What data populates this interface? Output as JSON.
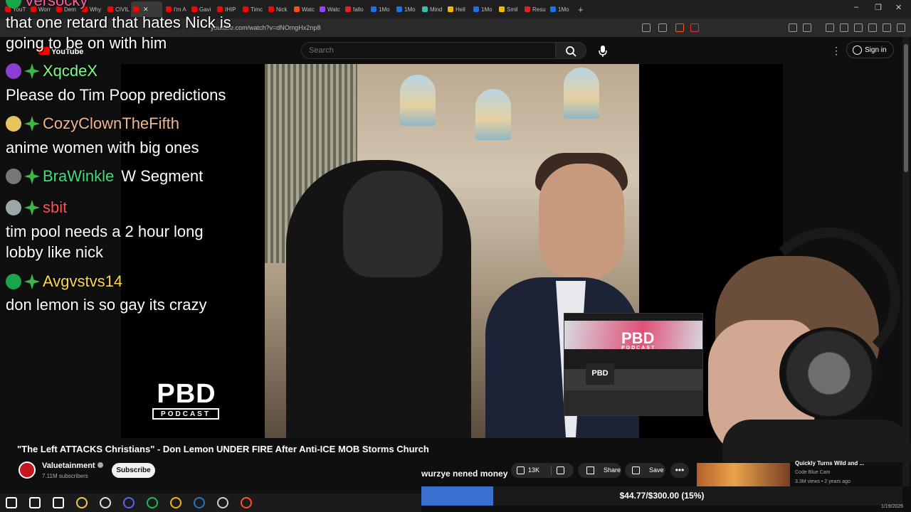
{
  "browser": {
    "tabs": [
      {
        "label": "YouT",
        "color": "#ff0000"
      },
      {
        "label": "Worr",
        "color": "#ff0000"
      },
      {
        "label": "Dem",
        "color": "#ff0000"
      },
      {
        "label": "Why",
        "color": "#ff0000"
      },
      {
        "label": "CIVIL",
        "color": "#ff0000"
      },
      {
        "label": "",
        "color": "#ff0000",
        "active": true
      },
      {
        "label": "I'm A",
        "color": "#ff0000"
      },
      {
        "label": "Gavi",
        "color": "#ff0000"
      },
      {
        "label": "IHIP",
        "color": "#ff0000"
      },
      {
        "label": "Timc",
        "color": "#ff0000"
      },
      {
        "label": "Nick",
        "color": "#ff0000"
      },
      {
        "label": "Watc",
        "color": "#ff4d1a"
      },
      {
        "label": "Watc",
        "color": "#9147ff"
      },
      {
        "label": "fallo",
        "color": "#e02424"
      },
      {
        "label": "1Mo",
        "color": "#1a73e8"
      },
      {
        "label": "1Mo",
        "color": "#1a73e8"
      },
      {
        "label": "Mind",
        "color": "#36c0a8"
      },
      {
        "label": "Hell",
        "color": "#f2b705"
      },
      {
        "label": "1Mo",
        "color": "#1a73e8"
      },
      {
        "label": "Smil",
        "color": "#f2b705"
      },
      {
        "label": "Resu",
        "color": "#e02424"
      },
      {
        "label": "1Mo",
        "color": "#1a73e8"
      }
    ],
    "new_tab": "+",
    "url": "youtube.com/watch?v=dNOmgHx2np8",
    "window_controls": {
      "minimize": "–",
      "restore": "❐",
      "close": "✕"
    }
  },
  "youtube": {
    "logo": "YouTube",
    "search_placeholder": "Search",
    "more_menu": "⋮",
    "sign_in": "Sign in",
    "video_title": "\"The Left ATTACKS Christians\" - Don Lemon UNDER FIRE After Anti-ICE MOB Storms Church",
    "channel": {
      "name": "Valuetainment",
      "subscribers": "7.11M subscribers",
      "subscribe": "Subscribe"
    },
    "actions": {
      "likes": "13K",
      "share": "Share",
      "save": "Save",
      "more": "•••"
    },
    "recommended": {
      "title": "Quickly Turns Wild and ...",
      "channel": "Code Blue Cam",
      "meta": "3.3M views • 2 years ago"
    }
  },
  "chat": {
    "top_user": "Versocky",
    "messages": [
      {
        "type": "text",
        "text": "that one retard that hates Nick is"
      },
      {
        "type": "text",
        "text": "going to be on with him"
      },
      {
        "type": "user",
        "name": "XqcdeX",
        "color": "#7cff83",
        "badge_color": "#8b3fd0"
      },
      {
        "type": "text",
        "text": "Please do Tim Poop predictions"
      },
      {
        "type": "user",
        "name": "CozyClownTheFifth",
        "color": "#f1b58f",
        "badge_color": "#e6c35c"
      },
      {
        "type": "text",
        "text": "anime women with big ones"
      },
      {
        "type": "user",
        "name": "BraWinkle",
        "color": "#3ee07a",
        "badge_color": "#777777",
        "inline": "W Segment"
      },
      {
        "type": "user",
        "name": "sbit",
        "color": "#ff5252",
        "badge_color": "#9aa6a8"
      },
      {
        "type": "text",
        "text": "tim pool needs a 2 hour long"
      },
      {
        "type": "text",
        "text": "lobby like nick"
      },
      {
        "type": "user",
        "name": "Avgvstvs14",
        "color": "#ffd84a",
        "badge_color": "#19a64a"
      },
      {
        "type": "text",
        "text": "don lemon is so gay its crazy"
      }
    ]
  },
  "overlay": {
    "pbd_logo": "PBD",
    "pbd_sub": "PODCAST",
    "pip_logo": "PBD",
    "pip_sub": "PODCAST",
    "pip_desk": "PBD",
    "tts_text": "wurzye nened money",
    "goal": {
      "label": "$44.77/$300.00 (15%)",
      "progress": 0.15,
      "color": "#3a6fd0"
    }
  },
  "taskbar": {
    "icons": [
      {
        "name": "windows-start-icon",
        "color": "#ffffff"
      },
      {
        "name": "taskbar-search-icon",
        "color": "#ffffff"
      },
      {
        "name": "task-view-icon",
        "color": "#ffffff"
      },
      {
        "name": "file-explorer-icon",
        "color": "#f5c84b"
      },
      {
        "name": "obs-icon",
        "color": "#e0e0e0"
      },
      {
        "name": "discord-icon",
        "color": "#5865f2"
      },
      {
        "name": "spotify-icon",
        "color": "#1db954"
      },
      {
        "name": "chrome-icon",
        "color": "#f2b705"
      },
      {
        "name": "steam-icon",
        "color": "#2a75bb"
      },
      {
        "name": "settings-icon",
        "color": "#cfcfcf"
      },
      {
        "name": "brave-icon",
        "color": "#fb542b"
      }
    ],
    "clock": "1/19/2026"
  }
}
